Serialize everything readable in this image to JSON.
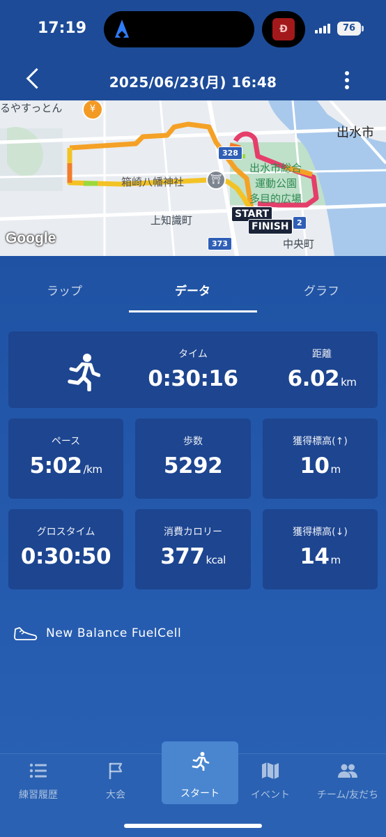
{
  "status_bar": {
    "time": "17:19",
    "battery": "76",
    "app_badge": "Ð"
  },
  "header": {
    "title": "2025/06/23(月) 16:48",
    "back_icon": "chevron-left-icon",
    "more_icon": "more-vertical-icon"
  },
  "map": {
    "labels": {
      "top_left": "るやすっとん",
      "city": "出水市",
      "park_line1": "出水市総合",
      "park_line2": "運動公園",
      "park_line3": "多目的広場",
      "shrine": "箱崎八幡神社",
      "town1": "上知識町",
      "town2": "中央町",
      "route_328": "328",
      "route_373": "373",
      "route_2": "2",
      "start": "START",
      "finish": "FINISH",
      "google": "Google"
    },
    "route_colors": [
      "#f4a126",
      "#f3c325",
      "#e53e6b",
      "#9ad93c",
      "#f27d2a"
    ]
  },
  "tabs": [
    {
      "label": "ラップ"
    },
    {
      "label": "データ"
    },
    {
      "label": "グラフ"
    }
  ],
  "active_tab": "データ",
  "stats": {
    "time": {
      "label": "タイム",
      "value": "0:30:16"
    },
    "distance": {
      "label": "距離",
      "value": "6.02",
      "unit": "km"
    },
    "pace": {
      "label": "ペース",
      "value": "5:02",
      "unit": "/km"
    },
    "steps": {
      "label": "歩数",
      "value": "5292"
    },
    "elev_gain": {
      "label": "獲得標高(↑)",
      "value": "10",
      "unit": "m"
    },
    "gross_time": {
      "label": "グロスタイム",
      "value": "0:30:50"
    },
    "calories": {
      "label": "消費カロリー",
      "value": "377",
      "unit": "kcal"
    },
    "elev_loss": {
      "label": "獲得標高(↓)",
      "value": "14",
      "unit": "m"
    }
  },
  "shoe": {
    "name": "New Balance FuelCell",
    "icon": "shoe-icon"
  },
  "bottom_nav": [
    {
      "label": "練習履歴",
      "icon": "list-icon"
    },
    {
      "label": "大会",
      "icon": "flag-icon"
    },
    {
      "label": "スタート",
      "icon": "runner-icon"
    },
    {
      "label": "イベント",
      "icon": "map-icon"
    },
    {
      "label": "チーム/友だち",
      "icon": "people-icon"
    }
  ],
  "active_nav": "スタート"
}
